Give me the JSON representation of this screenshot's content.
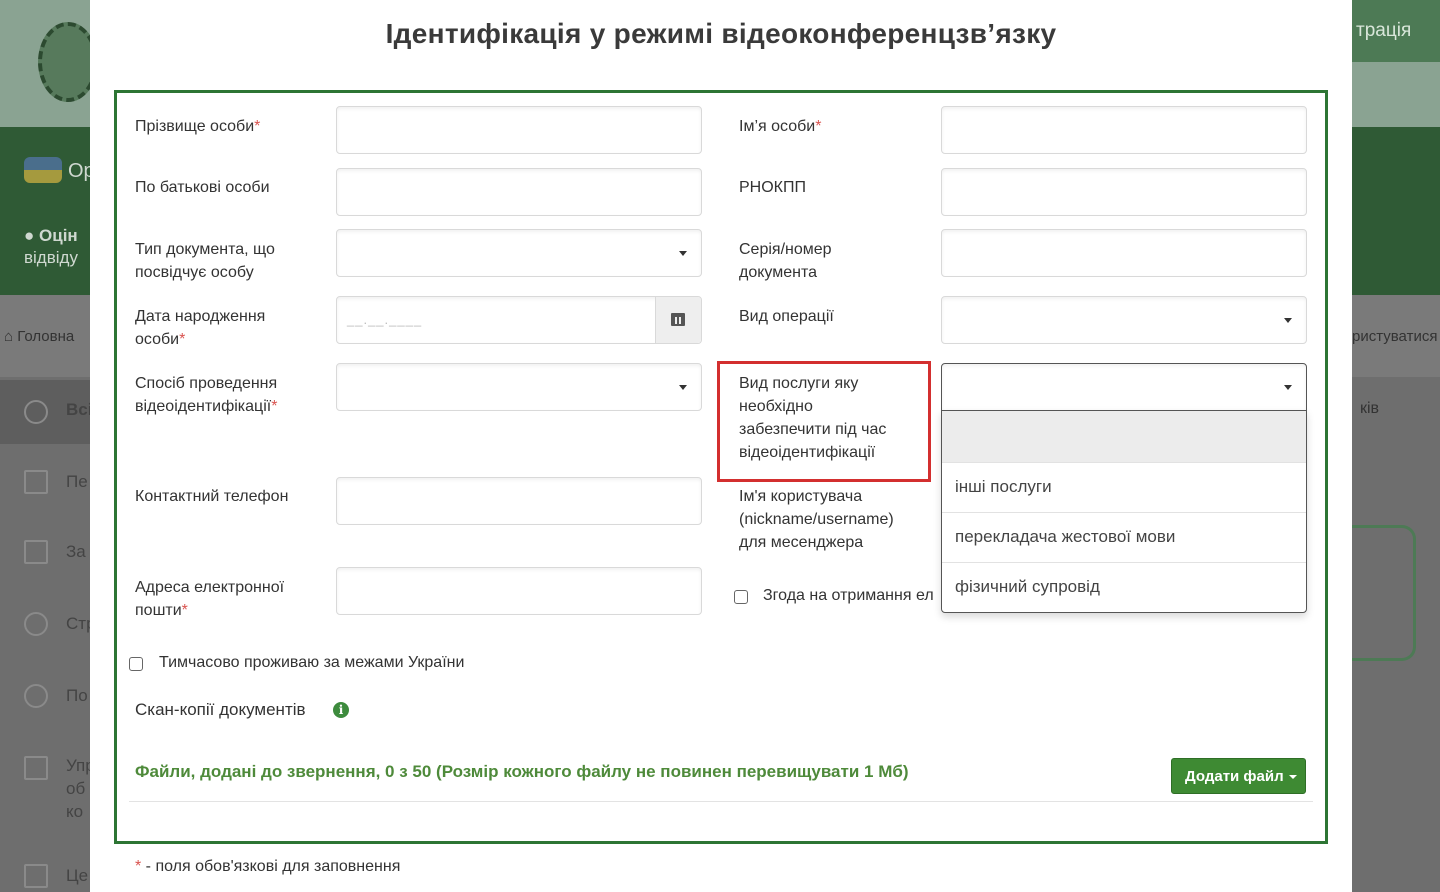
{
  "background": {
    "header_right_button": "трація",
    "banner_text_1": "Ор",
    "banner_text_2": "Оцін",
    "banner_text_3": "відвіду",
    "breadcrumb_home": "Головна",
    "breadcrumb_right": "ристуватися",
    "right_text": "ків",
    "sidebar_items": [
      "Всі",
      "Пе",
      "За",
      "Стр",
      "По",
      "Упр",
      "об",
      "ко",
      "Це"
    ]
  },
  "modal": {
    "title": "Ідентифікація у режимі відеоконференцзв’язку",
    "required_mark": "*",
    "fields": {
      "surname_label": "Прізвище особи",
      "name_label": "Ім’я особи",
      "patronymic_label": "По батькові особи",
      "rnokpp_label": "РНОКПП",
      "doc_type_label_1": "Тип документа, що",
      "doc_type_label_2": "посвідчує особу",
      "doc_number_label_1": "Серія/номер",
      "doc_number_label_2": "документа",
      "birthdate_label_1": "Дата народження",
      "birthdate_label_2": "особи",
      "birthdate_mask": "__.__.____",
      "operation_label": "Вид операції",
      "method_label_1": "Спосіб проведення",
      "method_label_2": "відеоідентифікації",
      "service_label_1": "Вид послуги яку",
      "service_label_2": "необхідно",
      "service_label_3": "забезпечити під час",
      "service_label_4": "відеоідентифікації",
      "phone_label": "Контактний телефон",
      "nickname_label_1": "Ім'я користувача",
      "nickname_label_2": "(nickname/username)",
      "nickname_label_3": "для месенджера",
      "email_label_1": "Адреса електронної",
      "email_label_2": "пошти",
      "consent_label": "Згода на отримання ел"
    },
    "service_dropdown_options": [
      "інші послуги",
      "перекладача жестової мови",
      "фізичний супровід"
    ],
    "abroad_label": "Тимчасово проживаю за межами України",
    "scans_label": "Скан-копії документів",
    "info_glyph": "i",
    "files_text": "Файли, додані до звернення, 0 з 50 (Розмір кожного файлу не повинен перевищувати 1 Мб)",
    "add_file_button": "Додати файл",
    "footnote_star": "*",
    "footnote_text": " - поля обов'язкові для заповнення"
  },
  "colors": {
    "primary_green": "#3e8a33",
    "frame_green": "#2d7534",
    "highlight_red": "#d32f2f",
    "required_red": "#d9534f"
  }
}
